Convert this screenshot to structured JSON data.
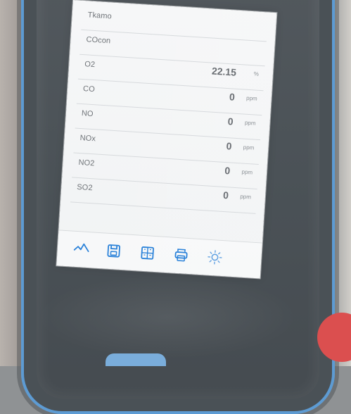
{
  "screen": {
    "rows": [
      {
        "label": "Tkamo",
        "value": "",
        "unit": ""
      },
      {
        "label": "COcon",
        "value": "",
        "unit": ""
      },
      {
        "label": "O2",
        "value": "22.15",
        "unit": "%"
      },
      {
        "label": "CO",
        "value": "0",
        "unit": "ppm"
      },
      {
        "label": "NO",
        "value": "0",
        "unit": "ppm"
      },
      {
        "label": "NOx",
        "value": "0",
        "unit": "ppm"
      },
      {
        "label": "NO2",
        "value": "0",
        "unit": "ppm"
      },
      {
        "label": "SO2",
        "value": "0",
        "unit": "ppm"
      }
    ]
  },
  "toolbar": {
    "icons": [
      {
        "name": "trend-icon"
      },
      {
        "name": "save-icon"
      },
      {
        "name": "grid-icon"
      },
      {
        "name": "print-icon"
      },
      {
        "name": "settings-icon"
      }
    ],
    "accent_color": "#2b82d9"
  },
  "device": {
    "frame_color": "#4b5257",
    "border_color": "#5d9bd3",
    "screen_color": "#f4f5f6"
  }
}
